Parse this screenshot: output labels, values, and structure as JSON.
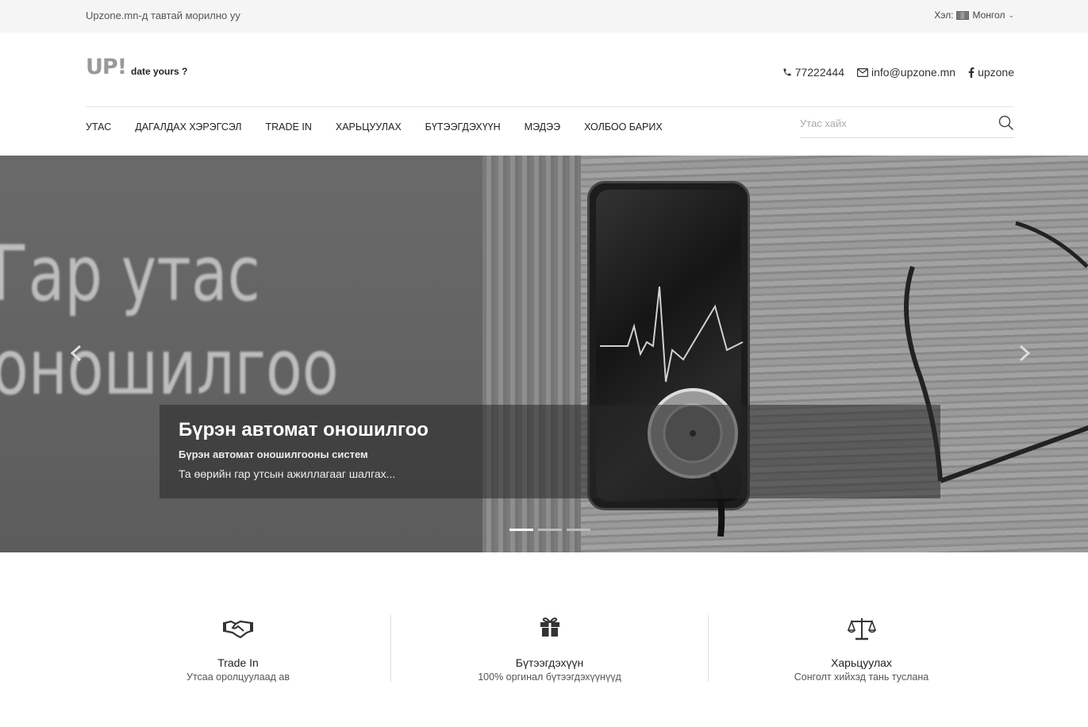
{
  "topbar": {
    "welcome": "Upzone.mn-д тавтай морилно уу",
    "lang_label": "Хэл:",
    "lang_value": "Монгол"
  },
  "header": {
    "logo_main": "UP!",
    "logo_tagline": "date yours ?",
    "phone": "77222444",
    "email": "info@upzone.mn",
    "facebook": "upzone"
  },
  "nav": {
    "items": [
      "УТАС",
      "ДАГАЛДАХ ХЭРЭГСЭЛ",
      "TRADE IN",
      "ХАРЬЦУУЛАХ",
      "БҮТЭЭГДЭХҮҮН",
      "МЭДЭЭ",
      "ХОЛБОО БАРИХ"
    ]
  },
  "search": {
    "placeholder": "Утас хайх"
  },
  "hero": {
    "background_text_line1": "Гар утас",
    "background_text_line2": "оношилгоо",
    "caption_title": "Бүрэн автомат оношилгоо",
    "caption_subtitle": "Бүрэн автомат оношилгооны систем",
    "caption_text": "Та өөрийн гар утсын ажиллагааг шалгах...",
    "slides_count": 3,
    "active_slide": 1
  },
  "features": [
    {
      "title": "Trade In",
      "desc": "Утсаа оролцуулаад ав",
      "icon": "handshake-icon"
    },
    {
      "title": "Бүтээгдэхүүн",
      "desc": "100% оргинал бүтээгдэхүүнүүд",
      "icon": "gift-icon"
    },
    {
      "title": "Харьцуулах",
      "desc": "Сонголт хийхэд тань туслана",
      "icon": "balance-scale-icon"
    }
  ]
}
